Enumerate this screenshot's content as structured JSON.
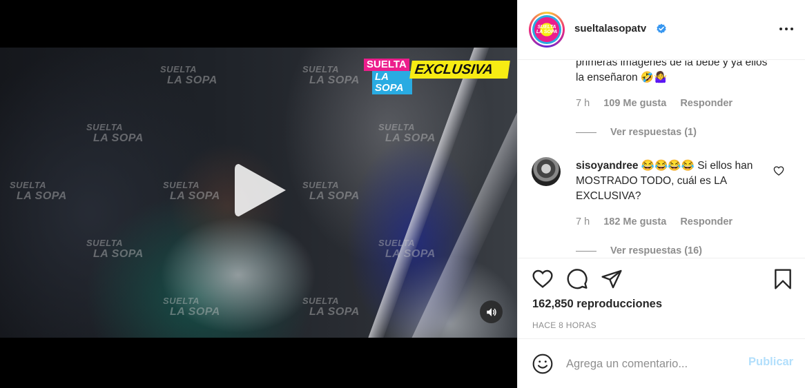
{
  "video": {
    "brand_line1": "SUELTA",
    "brand_line2": "LA SOPA",
    "brand_tag": "EXCLUSIVA",
    "watermark_line1": "SUELTA",
    "watermark_line2": "LA SOPA",
    "play_icon": "play-icon",
    "mute_icon": "volume-icon"
  },
  "post": {
    "account": "sueltalasopatv",
    "verified_icon": "verified-badge-icon",
    "more_icon": "more-options-icon"
  },
  "comments": [
    {
      "text": "primeras imágenes de la bebe y ya ellos la enseñaron 🤣🤷‍♀️",
      "time": "7 h",
      "likes": "109 Me gusta",
      "reply": "Responder",
      "view_replies": "Ver respuestas (1)"
    },
    {
      "user": "sisoyandree",
      "text": "😂😂😂😂 Si ellos han MOSTRADO TODO, cuál es LA EXCLUSIVA?",
      "time": "7 h",
      "likes": "182 Me gusta",
      "reply": "Responder",
      "view_replies": "Ver respuestas (16)"
    }
  ],
  "actions": {
    "views": "162,850 reproducciones",
    "timestamp": "HACE 8 HORAS"
  },
  "composer": {
    "placeholder": "Agrega un comentario...",
    "publish": "Publicar"
  },
  "colors": {
    "link_disabled": "#b2dffc",
    "meta_gray": "#8e8e8e",
    "verified_blue": "#3897f0",
    "brand_pink": "#ec1e8c",
    "brand_yellow": "#f7ec13",
    "brand_blue": "#29abe2"
  }
}
